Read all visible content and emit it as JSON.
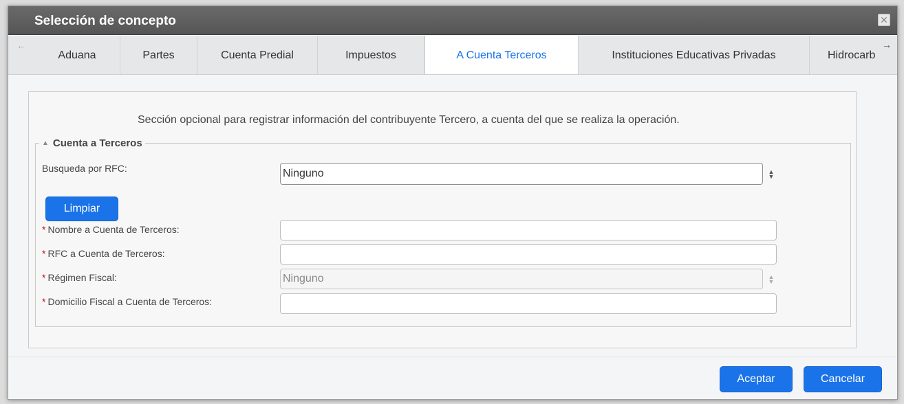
{
  "dialog": {
    "title": "Selección de concepto",
    "close_icon": "close-icon"
  },
  "tabs": [
    {
      "label": "Aduana",
      "active": false
    },
    {
      "label": "Partes",
      "active": false
    },
    {
      "label": "Cuenta Predial",
      "active": false
    },
    {
      "label": "Impuestos",
      "active": false
    },
    {
      "label": "A Cuenta Terceros",
      "active": true
    },
    {
      "label": "Instituciones Educativas Privadas",
      "active": false
    },
    {
      "label": "Hidrocarb",
      "active": false
    }
  ],
  "section": {
    "intro": "Sección opcional para registrar información del contribuyente Tercero, a cuenta del que se realiza la operación.",
    "legend": "Cuenta a Terceros"
  },
  "form": {
    "rfc_search_label": "Busqueda por RFC:",
    "rfc_search_value": "Ninguno",
    "clear_label": "Limpiar",
    "required_mark": "*",
    "nombre_label": "Nombre a Cuenta de Terceros:",
    "nombre_value": "",
    "rfc_label": "RFC a Cuenta de Terceros:",
    "rfc_value": "",
    "regimen_label": "Régimen Fiscal:",
    "regimen_value": "Ninguno",
    "domicilio_label": "Domicilio Fiscal a Cuenta de Terceros:",
    "domicilio_value": ""
  },
  "footer": {
    "accept_label": "Aceptar",
    "cancel_label": "Cancelar"
  },
  "colors": {
    "accent": "#1a73e8",
    "title_bar": "#5d5d5d",
    "required": "#d0021b"
  }
}
